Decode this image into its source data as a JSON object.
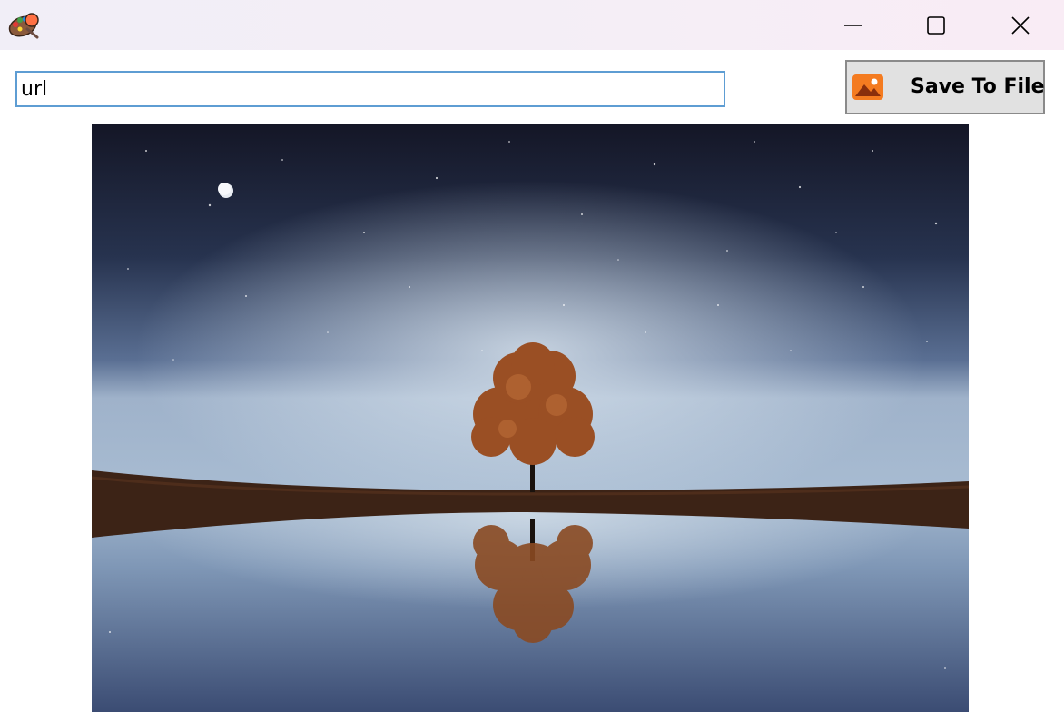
{
  "window": {
    "app_icon": "paint-palette-icon",
    "controls": {
      "minimize": "minimize-icon",
      "maximize": "maximize-icon",
      "close": "close-icon"
    }
  },
  "toolbar": {
    "url_value": "url",
    "save_label": "Save To File",
    "save_icon": "image-icon",
    "save_icon_color": "#f47b20"
  },
  "image": {
    "description_icon": "night-tree-reflection-image"
  },
  "colors": {
    "titlebar": "#f3eef7",
    "input_border": "#5e9dd3",
    "button_bg": "#e1e1e1"
  }
}
